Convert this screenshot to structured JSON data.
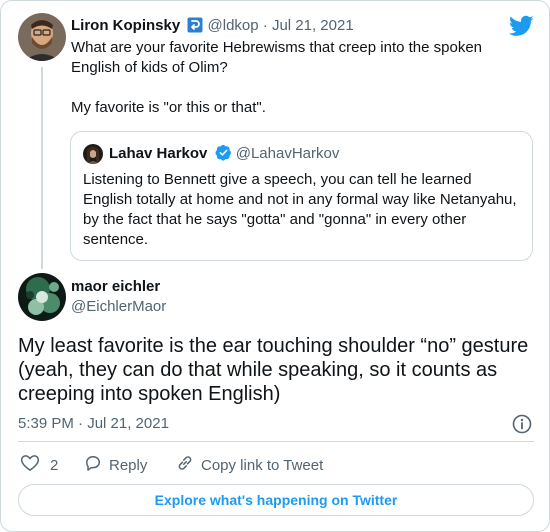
{
  "original_tweet": {
    "author_name": "Liron Kopinsky",
    "handle_date": "@ldkop · Jul 21, 2021",
    "text_lines": [
      "What are your favorite Hebrewisms that creep into the spoken English of kids of Olim?",
      "My favorite is \"or this or that\"."
    ]
  },
  "quoted_tweet": {
    "author_name": "Lahav Harkov",
    "handle": "@LahavHarkov",
    "text": "Listening to Bennett give a speech, you can tell he learned English totally at home and not in any formal way like Netanyahu, by the fact that he says \"gotta\" and \"gonna\" in every other sentence."
  },
  "main_tweet": {
    "author_name": "maor eichler",
    "handle": "@EichlerMaor",
    "text": "My least favorite is the ear touching shoulder “no” gesture (yeah, they can do that while speaking, so it counts as creeping into spoken English)",
    "timestamp": "5:39 PM · Jul 21, 2021"
  },
  "actions": {
    "like_count": "2",
    "reply_label": "Reply",
    "copy_label": "Copy link to Tweet"
  },
  "explore_label": "Explore what's happening on Twitter",
  "colors": {
    "twitter_blue": "#1d9bf0",
    "muted_text": "#536471",
    "border": "#cfd9de",
    "verified": "#1d9bf0"
  },
  "icons": [
    "twitter-bird-icon",
    "ldk-badge-icon",
    "verified-badge-icon",
    "info-icon",
    "heart-icon",
    "reply-icon",
    "link-icon"
  ]
}
